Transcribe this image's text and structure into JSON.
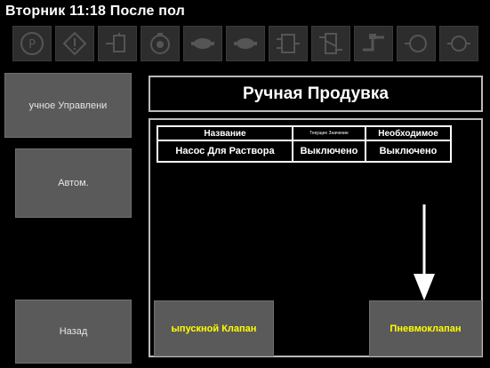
{
  "status": {
    "text": "Вторник 11:18 После пол"
  },
  "icon_names": [
    "parking-icon",
    "warning-icon",
    "valve-icon",
    "pump-icon",
    "motor-icon",
    "motor2-icon",
    "manifold-icon",
    "filter-icon",
    "pipe-icon",
    "tank-icon",
    "valve2-icon"
  ],
  "sidebar": {
    "manual_label": "учное Управлени",
    "auto_label": "Автом.",
    "back_label": "Назад"
  },
  "main": {
    "title": "Ручная Продувка",
    "table": {
      "headers": [
        "Название",
        "Текущее Значение",
        "Необходимое"
      ],
      "rows": [
        [
          "Насос Для Раствора",
          "Выключено",
          "Выключено"
        ]
      ]
    },
    "buttons": {
      "exhaust_valve": "ыпускной Клапан",
      "pneumo_valve": "Пневмоклапан"
    }
  },
  "colors": {
    "accent_text": "#ffff00",
    "button_bg": "#5a5a5a"
  }
}
